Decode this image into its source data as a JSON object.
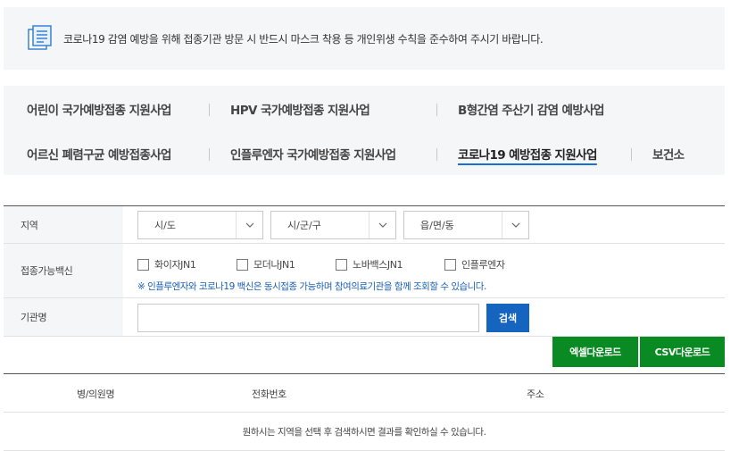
{
  "notice": {
    "icon": "document-list-icon",
    "text": "코로나19 감염 예방을 위해 접종기관 방문 시 반드시 마스크 착용 등 개인위생 수칙을 준수하여 주시기 바랍니다."
  },
  "tabs": [
    {
      "label": "어린이 국가예방접종 지원사업",
      "active": false
    },
    {
      "label": "HPV 국가예방접종 지원사업",
      "active": false
    },
    {
      "label": "B형간염 주산기 감염 예방사업",
      "active": false
    },
    {
      "label": "어르신 폐렴구균 예방접종사업",
      "active": false
    },
    {
      "label": "인플루엔자 국가예방접종 지원사업",
      "active": false
    },
    {
      "label": "코로나19 예방접종 지원사업",
      "active": true
    },
    {
      "label": "보건소",
      "active": false
    }
  ],
  "form": {
    "region_label": "지역",
    "selects": [
      {
        "value": "시/도"
      },
      {
        "value": "시/군/구"
      },
      {
        "value": "읍/면/동"
      }
    ],
    "vaccine_label": "접종가능백신",
    "vaccines": [
      {
        "label": "화이자JN1",
        "checked": false
      },
      {
        "label": "모더나JN1",
        "checked": false
      },
      {
        "label": "노바백스JN1",
        "checked": false
      },
      {
        "label": "인플루엔자",
        "checked": false
      }
    ],
    "vaccine_note": "※ 인플루엔자와 코로나19 백신은 동시접종 가능하며 참여의료기관을 함께 조회할 수 있습니다.",
    "org_label": "기관명",
    "org_value": "",
    "search_label": "검색"
  },
  "downloads": {
    "excel_label": "엑셀다운로드",
    "csv_label": "CSV다운로드"
  },
  "results": {
    "columns": [
      "병/의원명",
      "전화번호",
      "주소"
    ],
    "empty_message": "원하시는 지역을 선택 후 검색하시면 결과를 확인하실 수 있습니다."
  },
  "colors": {
    "accent_blue": "#1565c0",
    "download_green": "#0a8a22",
    "note_blue": "#1a5fb4",
    "panel_bg": "#f5f6f8"
  }
}
